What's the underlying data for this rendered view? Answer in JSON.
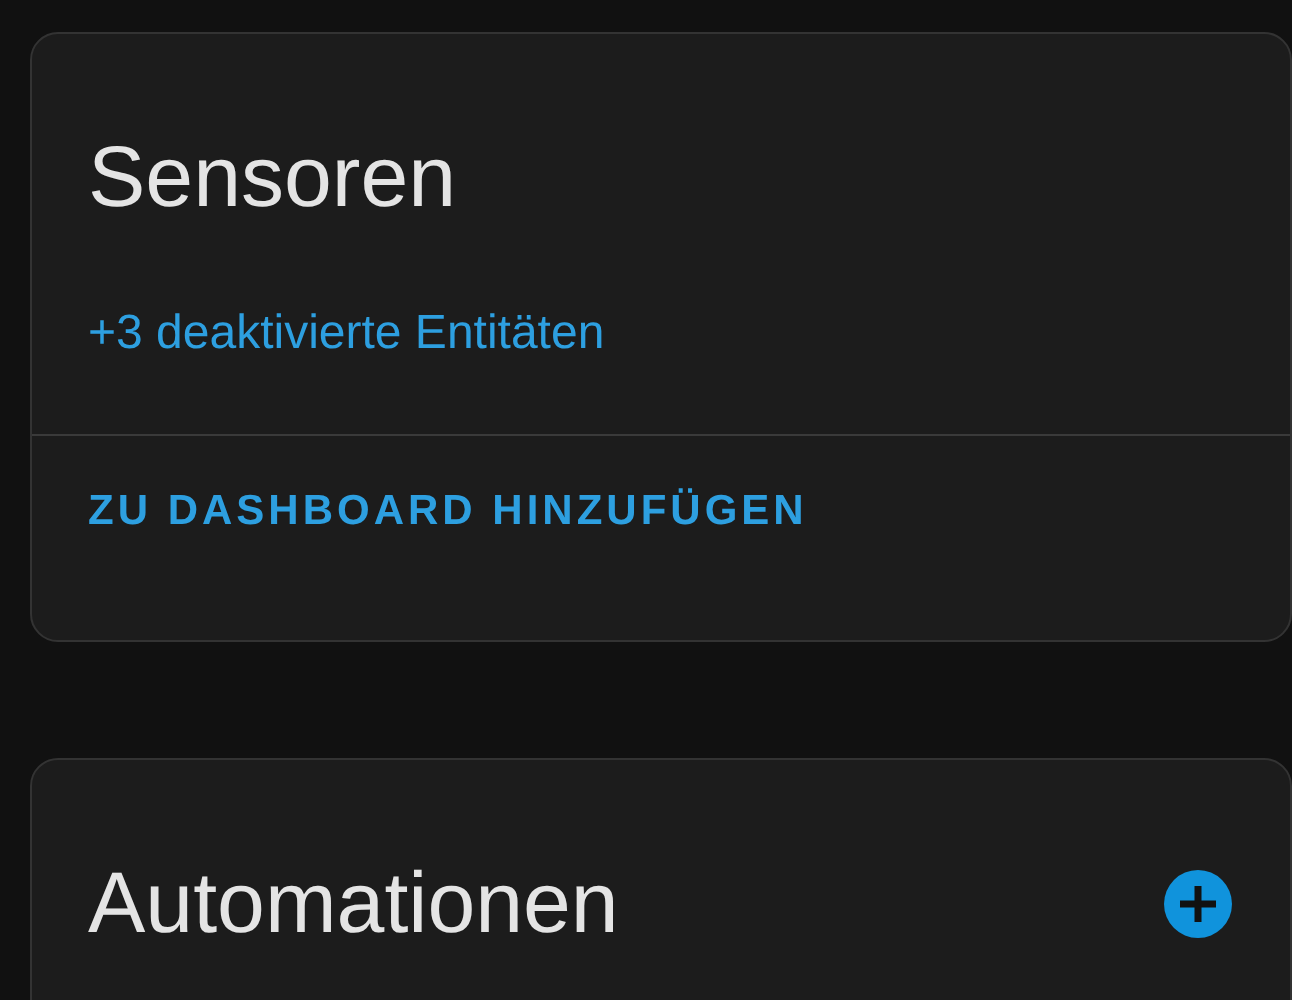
{
  "cards": [
    {
      "title": "Sensoren",
      "link": "+3 deaktivierte Entitäten",
      "action": "ZU DASHBOARD HINZUFÜGEN",
      "add_button": false
    },
    {
      "title": "Automationen",
      "add_button": true
    }
  ]
}
